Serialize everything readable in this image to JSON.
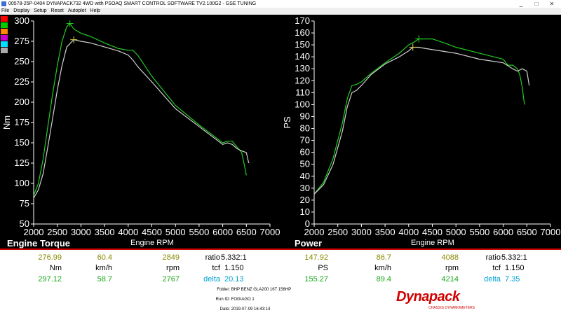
{
  "window": {
    "title": "00578-25P-0404 DYNAPACK732 4WD with PSOAQ SMART CONTROL SOFTWARE TV2.100G2 - GSE TUNING",
    "minimize": "_",
    "maximize": "□",
    "close": "✕"
  },
  "menu": [
    "File",
    "Display",
    "Setup",
    "Reset",
    "Autoplot",
    "Help"
  ],
  "legend_colors": [
    "#ff0000",
    "#00cc00",
    "#ff8800",
    "#cc00cc",
    "#00e0ff",
    "#aaaaaa"
  ],
  "colors": {
    "run1": "#22cc22",
    "run2": "#d0d0d0",
    "marker": "#d8d040",
    "accent": "#d00000"
  },
  "torque_panel": {
    "label": "Engine Torque",
    "xlabel": "Engine RPM",
    "ylabel": "Nm"
  },
  "power_panel": {
    "label": "Power",
    "xlabel": "Engine RPM",
    "ylabel": "PS"
  },
  "chart_data": [
    {
      "type": "line",
      "title": "Engine Torque",
      "xlabel": "Engine RPM",
      "ylabel": "Nm",
      "xlim": [
        2000,
        7000
      ],
      "ylim": [
        50,
        300
      ],
      "xticks": [
        2000,
        2500,
        3000,
        3500,
        4000,
        4500,
        5000,
        5500,
        6000,
        6500,
        7000
      ],
      "yticks": [
        50,
        75,
        100,
        125,
        150,
        175,
        200,
        225,
        250,
        275,
        300
      ],
      "grid": false,
      "peak_markers": [
        [
          2767,
          297
        ],
        [
          2849,
          277
        ]
      ],
      "series": [
        {
          "x": [
            2000,
            2100,
            2200,
            2300,
            2400,
            2500,
            2600,
            2700,
            2767,
            2850,
            3000,
            3200,
            3500,
            3800,
            4000,
            4100,
            4200,
            4500,
            5000,
            5500,
            6000,
            6100,
            6200,
            6300,
            6400,
            6450,
            6500
          ],
          "y": [
            85,
            100,
            130,
            170,
            210,
            245,
            275,
            293,
            297,
            290,
            285,
            281,
            273,
            266,
            264,
            264,
            258,
            232,
            196,
            172,
            150,
            152,
            152,
            145,
            138,
            125,
            110
          ]
        },
        {
          "x": [
            2000,
            2100,
            2200,
            2300,
            2400,
            2500,
            2600,
            2700,
            2849,
            3000,
            3200,
            3500,
            3800,
            4000,
            4100,
            4200,
            4500,
            5000,
            5500,
            6000,
            6100,
            6200,
            6300,
            6400,
            6500,
            6550
          ],
          "y": [
            82,
            92,
            112,
            145,
            180,
            215,
            245,
            268,
            277,
            275,
            273,
            268,
            263,
            258,
            252,
            244,
            225,
            192,
            170,
            148,
            150,
            148,
            143,
            140,
            138,
            125
          ]
        }
      ]
    },
    {
      "type": "line",
      "title": "Power",
      "xlabel": "Engine RPM",
      "ylabel": "PS",
      "xlim": [
        2000,
        7000
      ],
      "ylim": [
        0,
        170
      ],
      "xticks": [
        2000,
        2500,
        3000,
        3500,
        4000,
        4500,
        5000,
        5500,
        6000,
        6500,
        7000
      ],
      "yticks": [
        0,
        10,
        20,
        30,
        40,
        50,
        60,
        70,
        80,
        90,
        100,
        110,
        120,
        130,
        140,
        150,
        160,
        170
      ],
      "grid": false,
      "peak_markers": [
        [
          4214,
          155
        ],
        [
          4088,
          148
        ]
      ],
      "series": [
        {
          "x": [
            2000,
            2200,
            2400,
            2600,
            2700,
            2800,
            2900,
            3000,
            3200,
            3500,
            3800,
            4000,
            4100,
            4214,
            4300,
            4500,
            4800,
            5000,
            5500,
            6000,
            6100,
            6200,
            6300,
            6350,
            6400,
            6450
          ],
          "y": [
            25,
            35,
            55,
            85,
            105,
            116,
            117,
            119,
            126,
            135,
            143,
            150,
            152,
            155,
            155,
            155,
            151,
            148,
            143,
            138,
            133,
            133,
            130,
            125,
            115,
            100
          ]
        },
        {
          "x": [
            2000,
            2200,
            2400,
            2600,
            2700,
            2800,
            2900,
            3000,
            3200,
            3500,
            3800,
            4000,
            4088,
            4200,
            4500,
            5000,
            5500,
            6000,
            6200,
            6300,
            6400,
            6500,
            6550
          ],
          "y": [
            25,
            33,
            50,
            78,
            98,
            110,
            112,
            116,
            125,
            134,
            140,
            145,
            148,
            148,
            146,
            143,
            138,
            135,
            130,
            128,
            130,
            128,
            116
          ]
        }
      ]
    }
  ],
  "readout": {
    "torque": {
      "r1": {
        "v1": "276.99",
        "v2": "60.4",
        "v3": "2849",
        "k": "ratio",
        "kv": "5.332:1"
      },
      "r2": {
        "v1": "Nm",
        "v2": "km/h",
        "v3": "rpm",
        "k": "tcf",
        "kv": "1.150"
      },
      "r3": {
        "v1": "297.12",
        "v2": "58.7",
        "v3": "2767",
        "k": "delta",
        "kv": "20.13"
      }
    },
    "power": {
      "r1": {
        "v1": "147.92",
        "v2": "86.7",
        "v3": "4088",
        "k": "ratio",
        "kv": "5.332:1"
      },
      "r2": {
        "v1": "PS",
        "v2": "km/h",
        "v3": "rpm",
        "k": "tcf",
        "kv": "1.150"
      },
      "r3": {
        "v1": "155.27",
        "v2": "89.4",
        "v3": "4214",
        "k": "delta",
        "kv": "7.35"
      }
    }
  },
  "meta": {
    "folder_key": "Folder:",
    "folder": "BHP BENZ GLA200 16T 156HP",
    "run_key": "Run ID:",
    "run": "FOGIAGO 1",
    "date_key": "Date:",
    "date": "2019-07-09 16:43:14"
  },
  "logo": {
    "word": "Dynapack",
    "tag": "CHASSIS DYNAMOMETERS"
  }
}
